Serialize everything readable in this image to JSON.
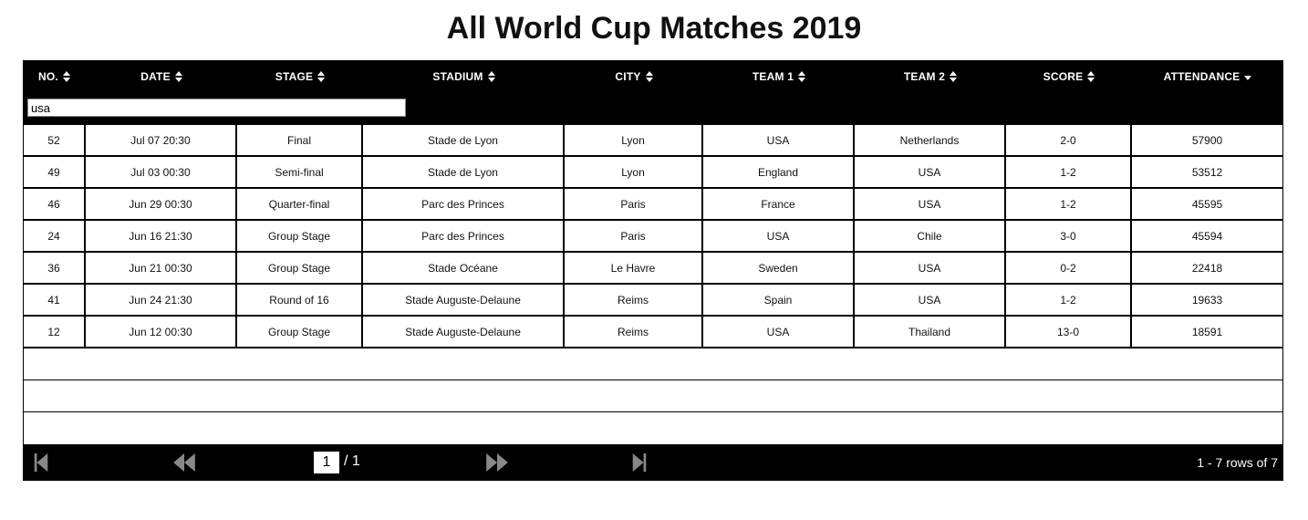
{
  "title": "All World Cup Matches 2019",
  "columns": [
    "NO.",
    "DATE",
    "STAGE",
    "STADIUM",
    "CITY",
    "TEAM 1",
    "TEAM 2",
    "SCORE",
    "ATTENDANCE"
  ],
  "filter": {
    "value": "usa"
  },
  "rows": [
    [
      "52",
      "Jul 07 20:30",
      "Final",
      "Stade de Lyon",
      "Lyon",
      "USA",
      "Netherlands",
      "2-0",
      "57900"
    ],
    [
      "49",
      "Jul 03 00:30",
      "Semi-final",
      "Stade de Lyon",
      "Lyon",
      "England",
      "USA",
      "1-2",
      "53512"
    ],
    [
      "46",
      "Jun 29 00:30",
      "Quarter-final",
      "Parc des Princes",
      "Paris",
      "France",
      "USA",
      "1-2",
      "45595"
    ],
    [
      "24",
      "Jun 16 21:30",
      "Group Stage",
      "Parc des Princes",
      "Paris",
      "USA",
      "Chile",
      "3-0",
      "45594"
    ],
    [
      "36",
      "Jun 21 00:30",
      "Group Stage",
      "Stade Océane",
      "Le Havre",
      "Sweden",
      "USA",
      "0-2",
      "22418"
    ],
    [
      "41",
      "Jun 24 21:30",
      "Round of 16",
      "Stade Auguste-Delaune",
      "Reims",
      "Spain",
      "USA",
      "1-2",
      "19633"
    ],
    [
      "12",
      "Jun 12 00:30",
      "Group Stage",
      "Stade Auguste-Delaune",
      "Reims",
      "USA",
      "Thailand",
      "13-0",
      "18591"
    ]
  ],
  "pager": {
    "current_page": "1",
    "total_pages": "/ 1",
    "rows_info": "1 - 7 rows of 7"
  },
  "sort": {
    "column": "ATTENDANCE",
    "direction": "descending"
  },
  "icons": {
    "first": "first-page-icon",
    "prev": "previous-page-icon",
    "next": "next-page-icon",
    "last": "last-page-icon"
  }
}
